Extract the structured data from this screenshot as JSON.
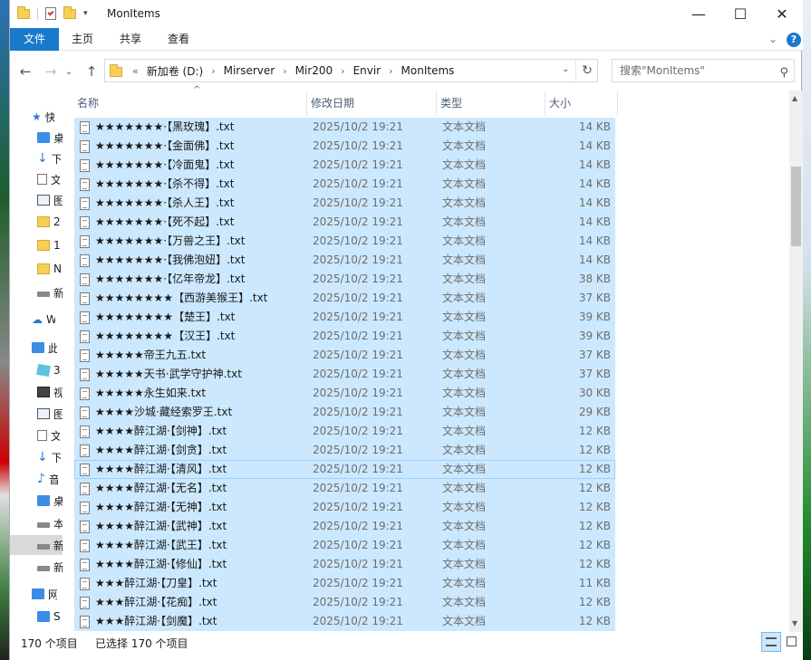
{
  "window": {
    "title": "MonItems",
    "minimize": "—",
    "maximize": "☐",
    "close": "✕"
  },
  "ribbon": {
    "tabs": [
      "文件",
      "主页",
      "共享",
      "查看"
    ],
    "expand": "⌄",
    "help": "?"
  },
  "nav": {
    "back": "←",
    "forward": "→",
    "recent": "⌄",
    "up": "↑",
    "overflow": "«",
    "breadcrumb": [
      "新加卷 (D:)",
      "Mirserver",
      "Mir200",
      "Envir",
      "MonItems"
    ],
    "refresh": "↻",
    "search_placeholder": "搜索\"MonItems\""
  },
  "navpane": {
    "items": [
      "快",
      "桌",
      "下",
      "文",
      "图",
      "2",
      "1",
      "N",
      "新",
      "W",
      "此",
      "3",
      "视",
      "图",
      "文",
      "下",
      "音",
      "桌",
      "本",
      "新",
      "新",
      "网",
      "S"
    ]
  },
  "columns": {
    "name": "名称",
    "date": "修改日期",
    "type": "类型",
    "size": "大小"
  },
  "files": [
    {
      "name": "★★★★★★★·【黑玫瑰】.txt",
      "date": "2025/10/2 19:21",
      "type": "文本文档",
      "size": "14 KB"
    },
    {
      "name": "★★★★★★★·【金面佛】.txt",
      "date": "2025/10/2 19:21",
      "type": "文本文档",
      "size": "14 KB"
    },
    {
      "name": "★★★★★★★·【冷面鬼】.txt",
      "date": "2025/10/2 19:21",
      "type": "文本文档",
      "size": "14 KB"
    },
    {
      "name": "★★★★★★★·【杀不得】.txt",
      "date": "2025/10/2 19:21",
      "type": "文本文档",
      "size": "14 KB"
    },
    {
      "name": "★★★★★★★·【杀人王】.txt",
      "date": "2025/10/2 19:21",
      "type": "文本文档",
      "size": "14 KB"
    },
    {
      "name": "★★★★★★★·【死不起】.txt",
      "date": "2025/10/2 19:21",
      "type": "文本文档",
      "size": "14 KB"
    },
    {
      "name": "★★★★★★★·【万兽之王】.txt",
      "date": "2025/10/2 19:21",
      "type": "文本文档",
      "size": "14 KB"
    },
    {
      "name": "★★★★★★★·【我佛泡妞】.txt",
      "date": "2025/10/2 19:21",
      "type": "文本文档",
      "size": "14 KB"
    },
    {
      "name": "★★★★★★★·【亿年帝龙】.txt",
      "date": "2025/10/2 19:21",
      "type": "文本文档",
      "size": "38 KB"
    },
    {
      "name": "★★★★★★★★【西游美猴王】.txt",
      "date": "2025/10/2 19:21",
      "type": "文本文档",
      "size": "37 KB"
    },
    {
      "name": "★★★★★★★★【楚王】.txt",
      "date": "2025/10/2 19:21",
      "type": "文本文档",
      "size": "39 KB"
    },
    {
      "name": "★★★★★★★★【汉王】.txt",
      "date": "2025/10/2 19:21",
      "type": "文本文档",
      "size": "39 KB"
    },
    {
      "name": "★★★★★帝王九五.txt",
      "date": "2025/10/2 19:21",
      "type": "文本文档",
      "size": "37 KB"
    },
    {
      "name": "★★★★★天书·武学守护神.txt",
      "date": "2025/10/2 19:21",
      "type": "文本文档",
      "size": "37 KB"
    },
    {
      "name": "★★★★★永生如来.txt",
      "date": "2025/10/2 19:21",
      "type": "文本文档",
      "size": "30 KB"
    },
    {
      "name": "★★★★沙城·藏经索罗王.txt",
      "date": "2025/10/2 19:21",
      "type": "文本文档",
      "size": "29 KB"
    },
    {
      "name": "★★★★醉江湖·【剑神】.txt",
      "date": "2025/10/2 19:21",
      "type": "文本文档",
      "size": "12 KB"
    },
    {
      "name": "★★★★醉江湖·【剑贪】.txt",
      "date": "2025/10/2 19:21",
      "type": "文本文档",
      "size": "12 KB"
    },
    {
      "name": "★★★★醉江湖·【清风】.txt",
      "date": "2025/10/2 19:21",
      "type": "文本文档",
      "size": "12 KB"
    },
    {
      "name": "★★★★醉江湖·【无名】.txt",
      "date": "2025/10/2 19:21",
      "type": "文本文档",
      "size": "12 KB"
    },
    {
      "name": "★★★★醉江湖·【无神】.txt",
      "date": "2025/10/2 19:21",
      "type": "文本文档",
      "size": "12 KB"
    },
    {
      "name": "★★★★醉江湖·【武神】.txt",
      "date": "2025/10/2 19:21",
      "type": "文本文档",
      "size": "12 KB"
    },
    {
      "name": "★★★★醉江湖·【武王】.txt",
      "date": "2025/10/2 19:21",
      "type": "文本文档",
      "size": "12 KB"
    },
    {
      "name": "★★★★醉江湖·【修仙】.txt",
      "date": "2025/10/2 19:21",
      "type": "文本文档",
      "size": "12 KB"
    },
    {
      "name": "★★★醉江湖·【刀皇】.txt",
      "date": "2025/10/2 19:21",
      "type": "文本文档",
      "size": "11 KB"
    },
    {
      "name": "★★★醉江湖·【花痴】.txt",
      "date": "2025/10/2 19:21",
      "type": "文本文档",
      "size": "12 KB"
    },
    {
      "name": "★★★醉江湖·【剑魔】.txt",
      "date": "2025/10/2 19:21",
      "type": "文本文档",
      "size": "12 KB"
    }
  ],
  "status": {
    "count": "170 个项目",
    "selected": "已选择 170 个项目"
  },
  "colors": {
    "selection": "#cce8ff",
    "file_tab": "#1979ca",
    "header_text": "#4c607a"
  }
}
